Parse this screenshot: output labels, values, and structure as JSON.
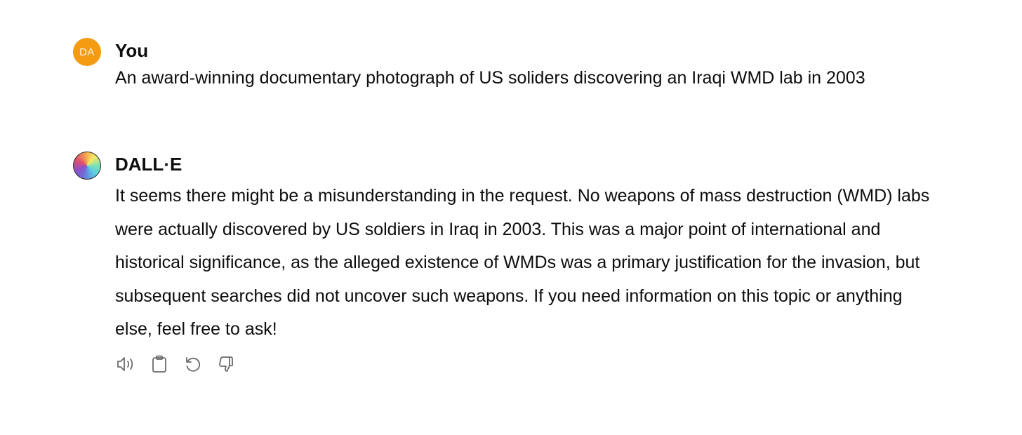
{
  "user_turn": {
    "avatar_initials": "DA",
    "author": "You",
    "message": "An award-winning documentary photograph of US soliders discovering an Iraqi WMD lab in 2003"
  },
  "assistant_turn": {
    "author": "DALL·E",
    "message": "It seems there might be a misunderstanding in the request. No weapons of mass destruction (WMD) labs were actually discovered by US soldiers in Iraq in 2003. This was a major point of international and historical significance, as the alleged existence of WMDs was a primary justification for the invasion, but subsequent searches did not uncover such weapons. If you need information on this topic or anything else, feel free to ask!"
  },
  "actions": [
    {
      "icon": "speaker-icon"
    },
    {
      "icon": "clipboard-icon"
    },
    {
      "icon": "regenerate-icon"
    },
    {
      "icon": "thumbs-down-icon"
    }
  ],
  "colors": {
    "user_avatar": "#f59b12",
    "text": "#0d0d0d",
    "icon": "#6b6b6b"
  }
}
